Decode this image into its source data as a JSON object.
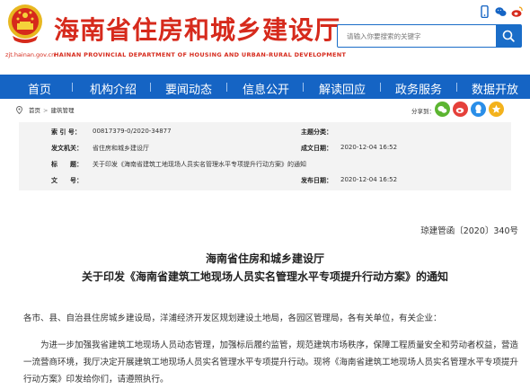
{
  "header": {
    "site_name": "海南省住房和城乡建设厅",
    "site_name_en": "HAINAN PROVINCIAL DEPARTMENT OF HOUSING AND URBAN-RURAL DEVELOPMENT",
    "domain": "zjt.hainan.gov.cn",
    "search_placeholder": "请输入你要搜索的关键字",
    "top_icons": [
      "mobile-icon",
      "wechat-icon",
      "weibo-icon"
    ]
  },
  "nav": {
    "items": [
      "首页",
      "机构介绍",
      "要闻动态",
      "信息公开",
      "解读回应",
      "政务服务",
      "数据开放"
    ]
  },
  "breadcrumb": {
    "home": "首页",
    "current": "建筑管理",
    "share_label": "分享到：",
    "share_icons": [
      "wechat-icon",
      "weibo-icon",
      "qq-icon",
      "qzone-icon"
    ]
  },
  "meta": {
    "index_label": "索 引 号：",
    "index_value": "00817379-0/2020-34877",
    "category_label": "主题分类：",
    "category_value": "",
    "issuer_label": "发文机关：",
    "issuer_value": "省住房和城乡建设厅",
    "created_label": "成文日期：",
    "created_value": "2020-12-04 16:52",
    "title_label": "标　　题：",
    "title_value": "关于印发《海南省建筑工地现场人员实名管理水平专项提升行动方案》的通知",
    "docno_label": "文　　号：",
    "docno_value": "",
    "published_label": "发布日期：",
    "published_value": "2020-12-04 16:52"
  },
  "document": {
    "doc_number": "琼建管函〔2020〕340号",
    "title_line1": "海南省住房和城乡建设厅",
    "title_line2": "关于印发《海南省建筑工地现场人员实名管理水平专项提升行动方案》的通知",
    "addressee": "各市、县、自治县住房城乡建设局，洋浦经济开发区规划建设土地局，各园区管理局，各有关单位，有关企业：",
    "paragraph1": "为进一步加强我省建筑工地现场人员动态管理，加强标后履约监管，规范建筑市场秩序，保障工程质量安全和劳动者权益，营造一流营商环境，我厅决定开展建筑工地现场人员实名管理水平专项提升行动。现将《海南省建筑工地现场人员实名管理水平专项提升行动方案》印发给你们，请遵照执行。"
  },
  "colors": {
    "brand_red": "#d62a1c",
    "nav_blue": "#1564c4"
  }
}
